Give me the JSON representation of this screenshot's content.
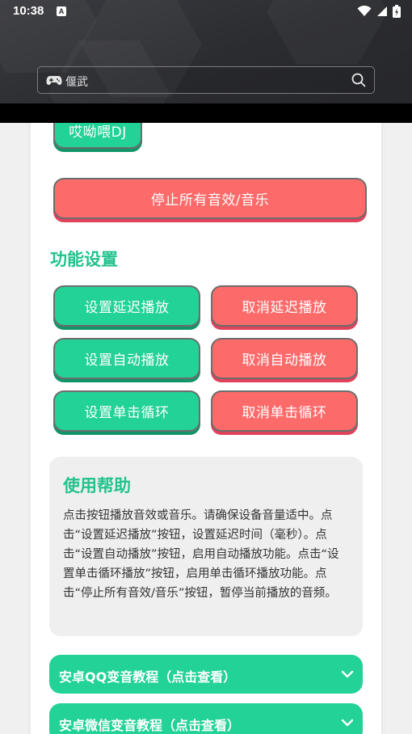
{
  "status": {
    "time": "10:38",
    "notif_icon": "A"
  },
  "search": {
    "value": "偃武"
  },
  "buttons": {
    "top_partial": "哎呦喂DJ",
    "stop_all": "停止所有音效/音乐"
  },
  "settings": {
    "title": "功能设置",
    "rows": [
      {
        "set": "设置延迟播放",
        "cancel": "取消延迟播放"
      },
      {
        "set": "设置自动播放",
        "cancel": "取消自动播放"
      },
      {
        "set": "设置单击循环",
        "cancel": "取消单击循环"
      }
    ]
  },
  "help": {
    "title": "使用帮助",
    "body": "点击按钮播放音效或音乐。请确保设备音量适中。点击“设置延迟播放”按钮，设置延迟时间（毫秒）。点击“设置自动播放”按钮，启用自动播放功能。点击“设置单击循环播放”按钮，启用单击循环播放功能。点击“停止所有音效/音乐”按钮，暂停当前播放的音频。"
  },
  "accordions": [
    {
      "label": "安卓QQ变音教程（点击查看）"
    },
    {
      "label": "安卓微信变音教程（点击查看）"
    }
  ],
  "colors": {
    "green": "#22d296",
    "red": "#fd6a6a",
    "title_green": "#22c28d",
    "header": "#2b2c30"
  }
}
